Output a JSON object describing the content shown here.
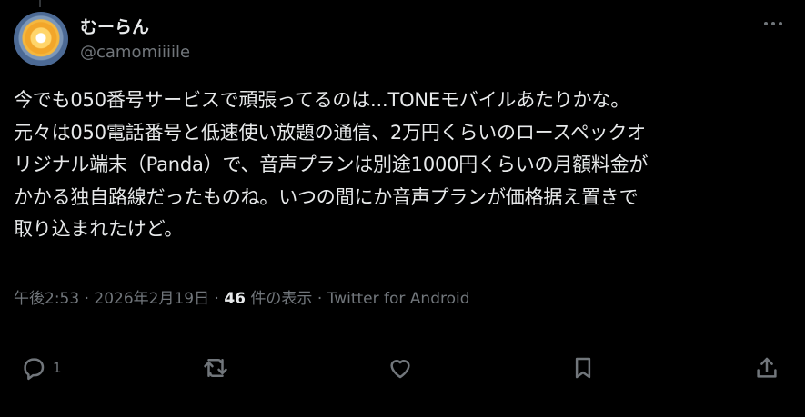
{
  "user": {
    "display_name": "むーらん",
    "handle": "@camomiiiile"
  },
  "tweet": {
    "text": "今でも050番号サービスで頑張ってるのは...TONEモバイルあたりかな。\n元々は050電話番号と低速使い放題の通信、2万円くらいのロースペックオ\nリジナル端末（Panda）で、音声プランは別途1000円くらいの月額料金が\nかかる独自路線だったものね。いつの間にか音声プランが価格据え置きで\n取り込まれたけど。"
  },
  "meta": {
    "time": "午後2:53",
    "sep1": " · ",
    "date": "2026年2月19日",
    "sep2": " · ",
    "views_count": "46",
    "views_label": " 件の表示",
    "sep3": " · ",
    "client": "Twitter for Android"
  },
  "actions": {
    "reply_count": "1",
    "icons": [
      "reply-icon",
      "retweet-icon",
      "like-icon",
      "bookmark-icon",
      "share-icon"
    ]
  },
  "colors": {
    "background": "#000000",
    "text": "#e7e9ea",
    "secondary": "#71767b",
    "divider": "#2f3336"
  }
}
